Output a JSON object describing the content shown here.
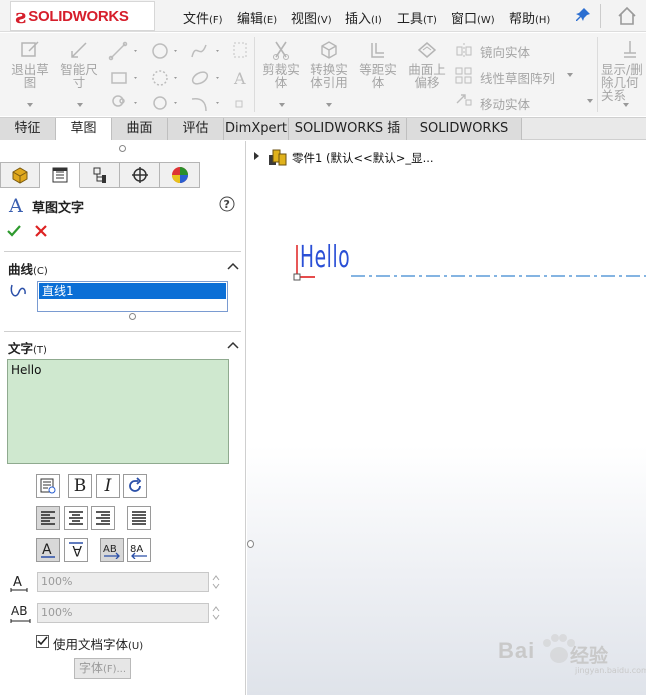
{
  "app": {
    "logo_text": "SOLIDWORKS"
  },
  "menu": [
    {
      "label": "文件",
      "acc": "(F)"
    },
    {
      "label": "编辑",
      "acc": "(E)"
    },
    {
      "label": "视图",
      "acc": "(V)"
    },
    {
      "label": "插入",
      "acc": "(I)"
    },
    {
      "label": "工具",
      "acc": "(T)"
    },
    {
      "label": "窗口",
      "acc": "(W)"
    },
    {
      "label": "帮助",
      "acc": "(H)"
    }
  ],
  "ribbon": {
    "exit_sketch": "退出草图",
    "smart_dim": "智能尺寸",
    "trim": "剪裁实体",
    "convert": "转换实体引用",
    "offset": "等距实体",
    "offset_surface": "曲面上偏移",
    "mirror": "镜向实体",
    "linear_pattern": "线性草图阵列",
    "move": "移动实体",
    "show_delete": "显示/删除几何关系"
  },
  "tabs": [
    {
      "label": "特征",
      "active": false
    },
    {
      "label": "草图",
      "active": true
    },
    {
      "label": "曲面",
      "active": false
    },
    {
      "label": "评估",
      "active": false
    },
    {
      "label": "DimXpert",
      "active": false
    },
    {
      "label": "SOLIDWORKS 插件",
      "active": false
    },
    {
      "label": "SOLIDWORKS MBD",
      "active": false
    }
  ],
  "property_manager": {
    "title": "草图文字",
    "curves_section": {
      "label": "曲线",
      "acc": "(C)",
      "items": [
        "直线1"
      ]
    },
    "text_section": {
      "label": "文字",
      "acc": "(T)",
      "value": "Hello"
    },
    "width_factor": "100%",
    "spacing": "100%",
    "use_doc_font": {
      "label": "使用文档字体",
      "acc": "(U)",
      "checked": true
    },
    "font_button": {
      "label": "字体",
      "acc": "(F)..."
    }
  },
  "tree": {
    "label": "零件1  (默认<<默认>_显..."
  },
  "sketch": {
    "text": "Hello",
    "color": "#2a4fd6"
  },
  "watermark": {
    "brand": "Bai",
    "sub": "经验",
    "url": "jingyan.baidu.com"
  }
}
